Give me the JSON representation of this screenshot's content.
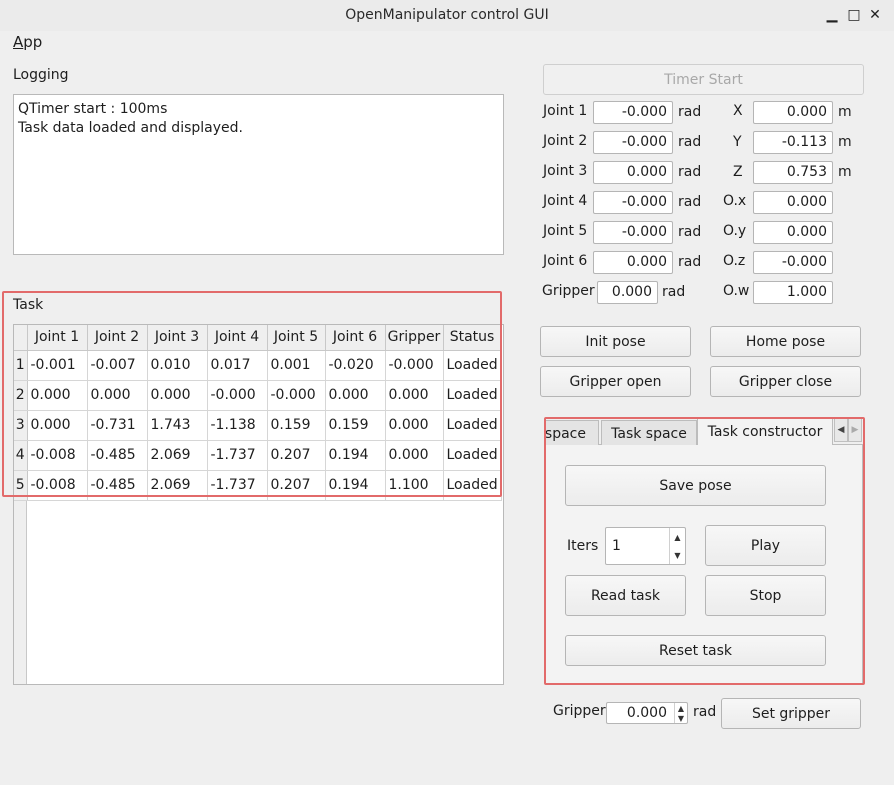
{
  "window": {
    "title": "OpenManipulator control GUI",
    "minimize": "▁",
    "maximize": "□",
    "close": "✕"
  },
  "menu": {
    "app_first": "A",
    "app_rest": "pp"
  },
  "logging": {
    "label": "Logging",
    "lines": [
      "QTimer start : 100ms",
      "Task data loaded and displayed."
    ]
  },
  "task": {
    "label": "Task",
    "columns": [
      "Joint 1",
      "Joint 2",
      "Joint 3",
      "Joint 4",
      "Joint 5",
      "Joint 6",
      "Gripper",
      "Status"
    ],
    "rows": [
      {
        "index": "1",
        "cells": [
          "-0.001",
          "-0.007",
          "0.010",
          "0.017",
          "0.001",
          "-0.020",
          "-0.000",
          "Loaded"
        ]
      },
      {
        "index": "2",
        "cells": [
          "0.000",
          "0.000",
          "0.000",
          "-0.000",
          "-0.000",
          "0.000",
          "0.000",
          "Loaded"
        ]
      },
      {
        "index": "3",
        "cells": [
          "0.000",
          "-0.731",
          "1.743",
          "-1.138",
          "0.159",
          "0.159",
          "0.000",
          "Loaded"
        ]
      },
      {
        "index": "4",
        "cells": [
          "-0.008",
          "-0.485",
          "2.069",
          "-1.737",
          "0.207",
          "0.194",
          "0.000",
          "Loaded"
        ]
      },
      {
        "index": "5",
        "cells": [
          "-0.008",
          "-0.485",
          "2.069",
          "-1.737",
          "0.207",
          "0.194",
          "1.100",
          "Loaded"
        ]
      }
    ]
  },
  "timer_button": "Timer Start",
  "joints": [
    {
      "label": "Joint 1",
      "value": "-0.000",
      "unit": "rad"
    },
    {
      "label": "Joint 2",
      "value": "-0.000",
      "unit": "rad"
    },
    {
      "label": "Joint 3",
      "value": "0.000",
      "unit": "rad"
    },
    {
      "label": "Joint 4",
      "value": "-0.000",
      "unit": "rad"
    },
    {
      "label": "Joint 5",
      "value": "-0.000",
      "unit": "rad"
    },
    {
      "label": "Joint 6",
      "value": "0.000",
      "unit": "rad"
    },
    {
      "label": "Gripper",
      "value": "0.000",
      "unit": "rad"
    }
  ],
  "pose": [
    {
      "label": "X",
      "value": "0.000",
      "unit": "m"
    },
    {
      "label": "Y",
      "value": "-0.113",
      "unit": "m"
    },
    {
      "label": "Z",
      "value": "0.753",
      "unit": "m"
    },
    {
      "label": "O.x",
      "value": "0.000",
      "unit": ""
    },
    {
      "label": "O.y",
      "value": "0.000",
      "unit": ""
    },
    {
      "label": "O.z",
      "value": "-0.000",
      "unit": ""
    },
    {
      "label": "O.w",
      "value": "1.000",
      "unit": ""
    }
  ],
  "buttons": {
    "init_pose": "Init pose",
    "home_pose": "Home pose",
    "gripper_open": "Gripper open",
    "gripper_close": "Gripper close"
  },
  "tabs": {
    "items": [
      "space",
      "Task space",
      "Task constructor"
    ],
    "scroll_left": "◀",
    "scroll_right": "▶",
    "constructor": {
      "save_pose": "Save pose",
      "iters_label": "Iters",
      "iters_value": "1",
      "play": "Play",
      "read_task": "Read task",
      "stop": "Stop",
      "reset_task": "Reset task"
    }
  },
  "bottom": {
    "gripper_label": "Gripper",
    "gripper_value": "0.000",
    "unit": "rad",
    "set_gripper": "Set gripper"
  },
  "spin_up": "▲",
  "spin_down": "▼"
}
